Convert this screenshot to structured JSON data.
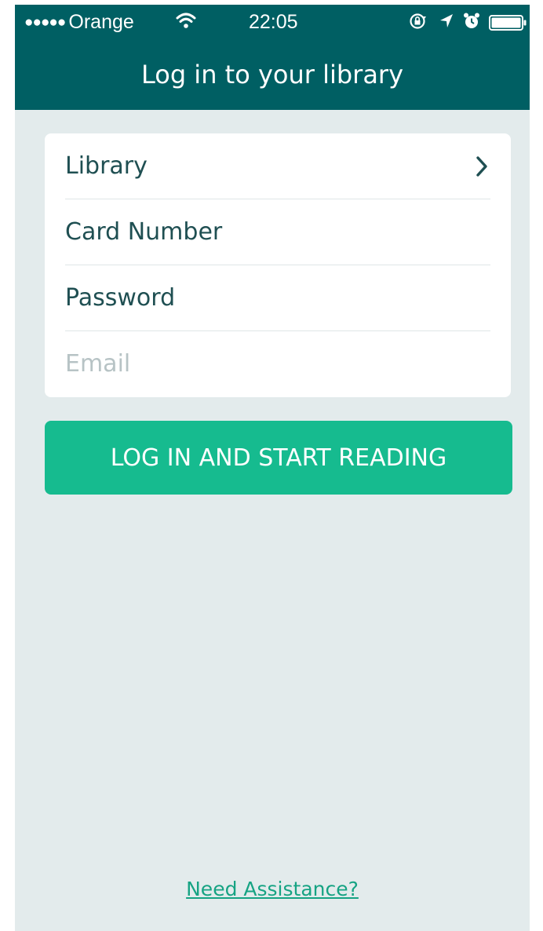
{
  "status_bar": {
    "signal": "●●●●●",
    "carrier": "Orange",
    "time": "22:05",
    "icons": [
      "wifi-icon",
      "orientation-lock-icon",
      "location-icon",
      "alarm-icon",
      "battery-icon"
    ]
  },
  "header": {
    "title": "Log in to your library"
  },
  "form": {
    "library_label": "Library",
    "card_number_label": "Card Number",
    "password_label": "Password",
    "email_placeholder": "Email"
  },
  "actions": {
    "login_label": "LOG IN AND START READING"
  },
  "footer": {
    "assistance_label": "Need Assistance?"
  },
  "colors": {
    "header_bg": "#005f63",
    "page_bg": "#e3ebec",
    "accent": "#16bb8f",
    "text": "#1f4f52",
    "placeholder": "#b7c3c5"
  }
}
